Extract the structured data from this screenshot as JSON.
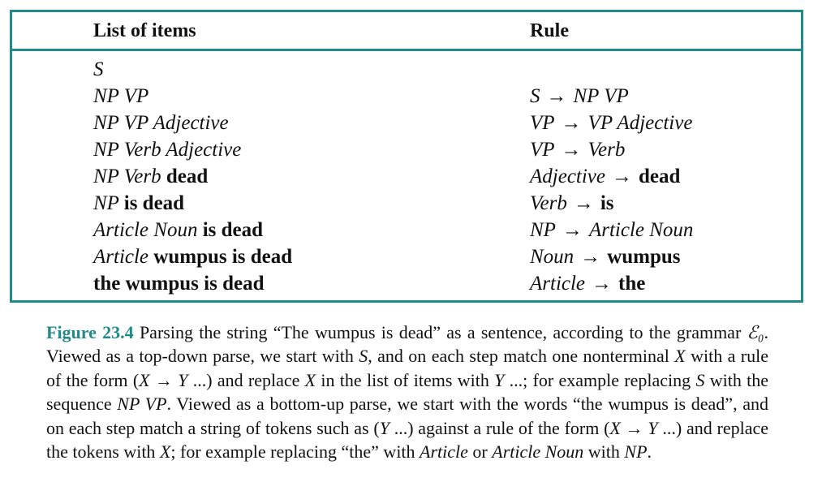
{
  "table": {
    "headers": {
      "items": "List of items",
      "rule": "Rule"
    },
    "items": [
      [
        {
          "t": "S",
          "s": "it"
        }
      ],
      [
        {
          "t": "NP VP",
          "s": "it"
        }
      ],
      [
        {
          "t": "NP VP Adjective",
          "s": "it"
        }
      ],
      [
        {
          "t": "NP Verb Adjective",
          "s": "it"
        }
      ],
      [
        {
          "t": "NP Verb ",
          "s": "it"
        },
        {
          "t": "dead",
          "s": "bd"
        }
      ],
      [
        {
          "t": "NP ",
          "s": "it"
        },
        {
          "t": "is dead",
          "s": "bd"
        }
      ],
      [
        {
          "t": "Article Noun ",
          "s": "it"
        },
        {
          "t": "is dead",
          "s": "bd"
        }
      ],
      [
        {
          "t": "Article ",
          "s": "it"
        },
        {
          "t": "wumpus is dead",
          "s": "bd"
        }
      ],
      [
        {
          "t": "the wumpus is dead",
          "s": "bd"
        }
      ]
    ],
    "rules": [
      [],
      [
        {
          "t": "S",
          "s": "it"
        },
        {
          "t": "→",
          "s": "ar"
        },
        {
          "t": "NP VP",
          "s": "it"
        }
      ],
      [
        {
          "t": "VP",
          "s": "it"
        },
        {
          "t": "→",
          "s": "ar"
        },
        {
          "t": "VP Adjective",
          "s": "it"
        }
      ],
      [
        {
          "t": "VP",
          "s": "it"
        },
        {
          "t": "→",
          "s": "ar"
        },
        {
          "t": "Verb",
          "s": "it"
        }
      ],
      [
        {
          "t": "Adjective",
          "s": "it"
        },
        {
          "t": "→",
          "s": "ar"
        },
        {
          "t": "dead",
          "s": "bd"
        }
      ],
      [
        {
          "t": "Verb",
          "s": "it"
        },
        {
          "t": "→",
          "s": "ar"
        },
        {
          "t": "is",
          "s": "bd"
        }
      ],
      [
        {
          "t": "NP",
          "s": "it"
        },
        {
          "t": "→",
          "s": "ar"
        },
        {
          "t": "Article Noun",
          "s": "it"
        }
      ],
      [
        {
          "t": "Noun",
          "s": "it"
        },
        {
          "t": "→",
          "s": "ar"
        },
        {
          "t": "wumpus",
          "s": "bd"
        }
      ],
      [
        {
          "t": "Article",
          "s": "it"
        },
        {
          "t": "→",
          "s": "ar"
        },
        {
          "t": "the",
          "s": "bd"
        }
      ]
    ]
  },
  "caption": {
    "label": "Figure 23.4",
    "segments": [
      {
        "t": " Parsing the string “The wumpus is dead” as a sentence, according to the grammar ",
        "s": ""
      },
      {
        "t": "ℰ₀",
        "s": "it"
      },
      {
        "t": ". Viewed as a top-down parse, we start with ",
        "s": ""
      },
      {
        "t": "S",
        "s": "it"
      },
      {
        "t": ", and on each step match one nonterminal ",
        "s": ""
      },
      {
        "t": "X",
        "s": "it"
      },
      {
        "t": " with a rule of the form (",
        "s": ""
      },
      {
        "t": "X",
        "s": "it"
      },
      {
        "t": " → ",
        "s": ""
      },
      {
        "t": "Y",
        "s": "it"
      },
      {
        "t": " ...) and replace ",
        "s": ""
      },
      {
        "t": "X",
        "s": "it"
      },
      {
        "t": " in the list of items with ",
        "s": ""
      },
      {
        "t": "Y",
        "s": "it"
      },
      {
        "t": " ...; for example replacing ",
        "s": ""
      },
      {
        "t": "S",
        "s": "it"
      },
      {
        "t": " with the sequence ",
        "s": ""
      },
      {
        "t": "NP VP",
        "s": "it"
      },
      {
        "t": ". Viewed as a bottom-up parse, we start with the words “the wumpus is dead”, and on each step match a string of tokens such as (",
        "s": ""
      },
      {
        "t": "Y",
        "s": "it"
      },
      {
        "t": " ...) against a rule of the form (",
        "s": ""
      },
      {
        "t": "X",
        "s": "it"
      },
      {
        "t": " → ",
        "s": ""
      },
      {
        "t": "Y",
        "s": "it"
      },
      {
        "t": " ...) and replace the tokens with ",
        "s": ""
      },
      {
        "t": "X",
        "s": "it"
      },
      {
        "t": "; for example replacing “the” with ",
        "s": ""
      },
      {
        "t": "Article",
        "s": "it"
      },
      {
        "t": " or ",
        "s": ""
      },
      {
        "t": "Article Noun",
        "s": "it"
      },
      {
        "t": " with ",
        "s": ""
      },
      {
        "t": "NP",
        "s": "it"
      },
      {
        "t": ".",
        "s": ""
      }
    ]
  },
  "colors": {
    "accent": "#1f8a86"
  }
}
